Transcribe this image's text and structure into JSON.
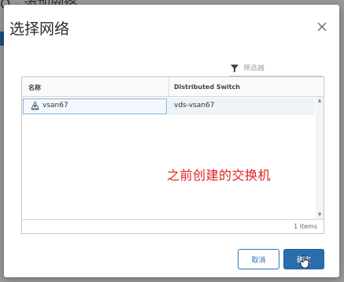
{
  "background": {
    "partial_title": "O - 添加网络"
  },
  "dialog": {
    "title": "选择网络",
    "close_icon": "close-icon"
  },
  "filter": {
    "placeholder": "筛选器",
    "icon": "filter-icon"
  },
  "grid": {
    "columns": [
      "名称",
      "Distributed Switch"
    ],
    "rows": [
      {
        "name": "vsan67",
        "switch": "vds-vsan67",
        "icon": "network-icon",
        "selected": true
      }
    ],
    "footer_count": "1 items"
  },
  "annotation": {
    "text": "之前创建的交换机",
    "color": "#e02020"
  },
  "buttons": {
    "cancel_label": "取消",
    "ok_label": "确定"
  },
  "colors": {
    "accent": "#2b6cad",
    "selection_border": "#8ab7de"
  }
}
